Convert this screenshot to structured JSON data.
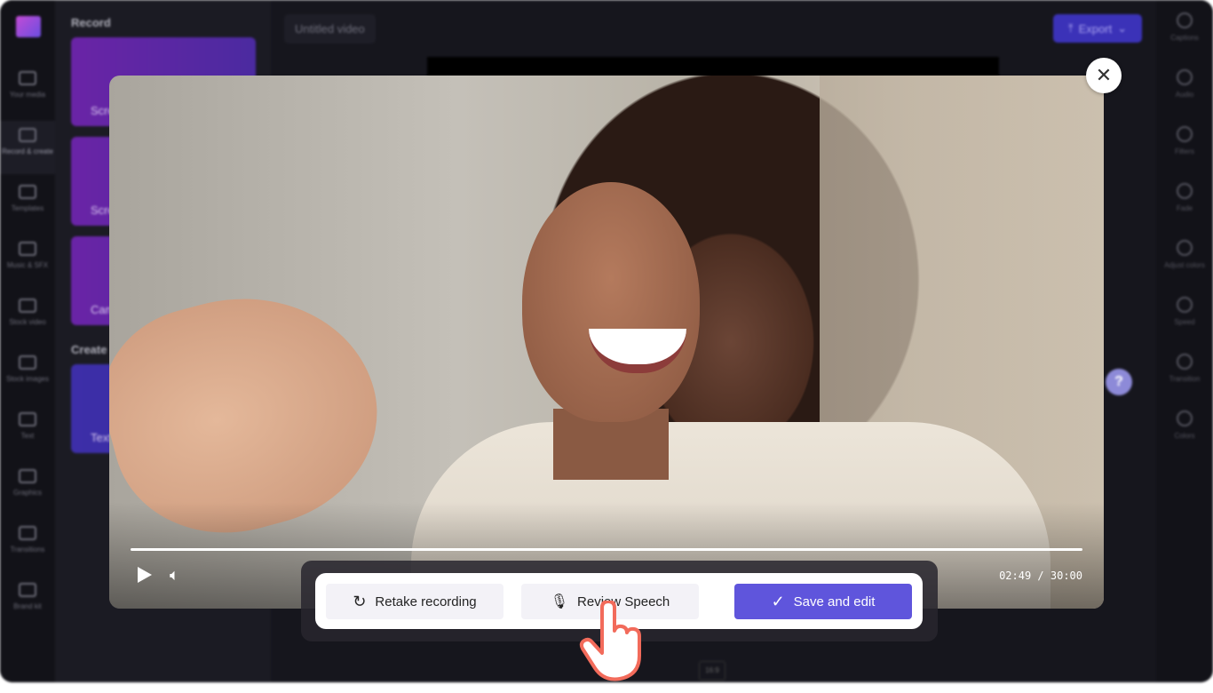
{
  "sidebar": {
    "items": [
      {
        "label": "Your media",
        "icon": "folder-icon"
      },
      {
        "label": "Record & create",
        "icon": "video-camera-icon",
        "active": true
      },
      {
        "label": "Templates",
        "icon": "templates-icon"
      },
      {
        "label": "Music & SFX",
        "icon": "music-icon"
      },
      {
        "label": "Stock video",
        "icon": "stock-video-icon"
      },
      {
        "label": "Stock images",
        "icon": "image-icon"
      },
      {
        "label": "Text",
        "icon": "text-icon"
      },
      {
        "label": "Graphics",
        "icon": "graphics-icon"
      },
      {
        "label": "Transitions",
        "icon": "transitions-icon"
      },
      {
        "label": "Brand kit",
        "icon": "brand-kit-icon"
      }
    ]
  },
  "panel": {
    "record_heading": "Record",
    "create_heading": "Create",
    "cards": [
      "Screen and camera",
      "Screen",
      "Camera"
    ],
    "create_cards": [
      "Text to speech"
    ]
  },
  "topbar": {
    "title": "Untitled video",
    "export_label": "Export"
  },
  "right_rail": {
    "items": [
      "Captions",
      "Audio",
      "Filters",
      "Fade",
      "Adjust colors",
      "Speed",
      "Transition",
      "Colors"
    ]
  },
  "help_label": "?",
  "aspect_label": "16:9",
  "player": {
    "time": "02:49 / 30:00",
    "progress": 0.094
  },
  "actions": {
    "retake": "Retake recording",
    "review": "Review Speech",
    "save": "Save and edit"
  },
  "colors": {
    "accent": "#5f55dc",
    "export": "#3b32b8",
    "cursor": "#f26b5b"
  }
}
